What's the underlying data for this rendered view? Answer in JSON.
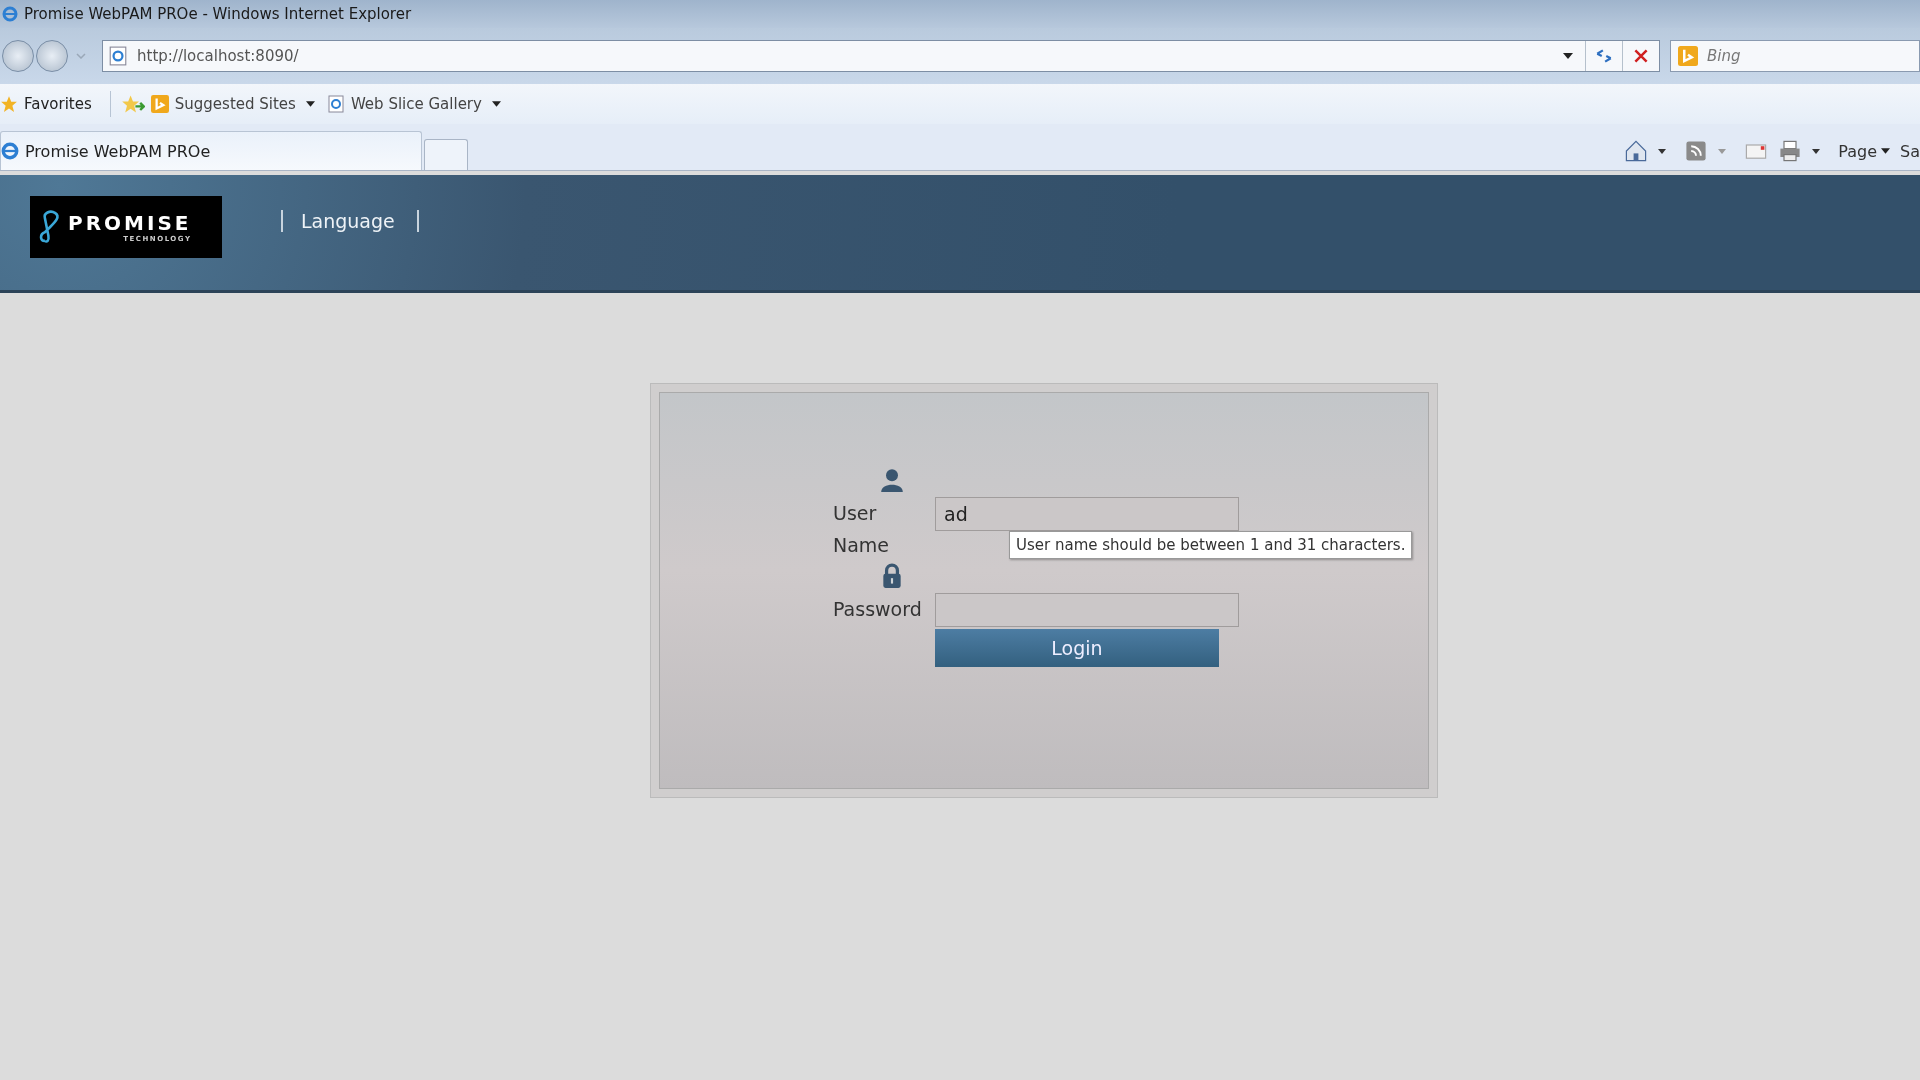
{
  "window": {
    "title": "Promise WebPAM PROe - Windows Internet Explorer"
  },
  "address_bar": {
    "url": "http://localhost:8090/"
  },
  "search": {
    "placeholder": "Bing"
  },
  "favorites_bar": {
    "favorites": "Favorites",
    "links": [
      {
        "label": "Suggested Sites",
        "kind": "bing"
      },
      {
        "label": "Web Slice Gallery",
        "kind": "page"
      }
    ]
  },
  "tabs": [
    {
      "label": "Promise WebPAM PROe",
      "selected": true
    }
  ],
  "command_bar": {
    "menus": [
      "Page",
      "Sa"
    ]
  },
  "header": {
    "logo": {
      "name": "PROMISE",
      "tagline": "TECHNOLOGY"
    },
    "nav": [
      "Language"
    ]
  },
  "login": {
    "fields": [
      {
        "kind": "user",
        "label": "User Name",
        "value": "ad"
      },
      {
        "kind": "password",
        "label": "Password"
      }
    ],
    "tooltip": "User name should be between 1 and 31 characters.",
    "button": "Login"
  }
}
